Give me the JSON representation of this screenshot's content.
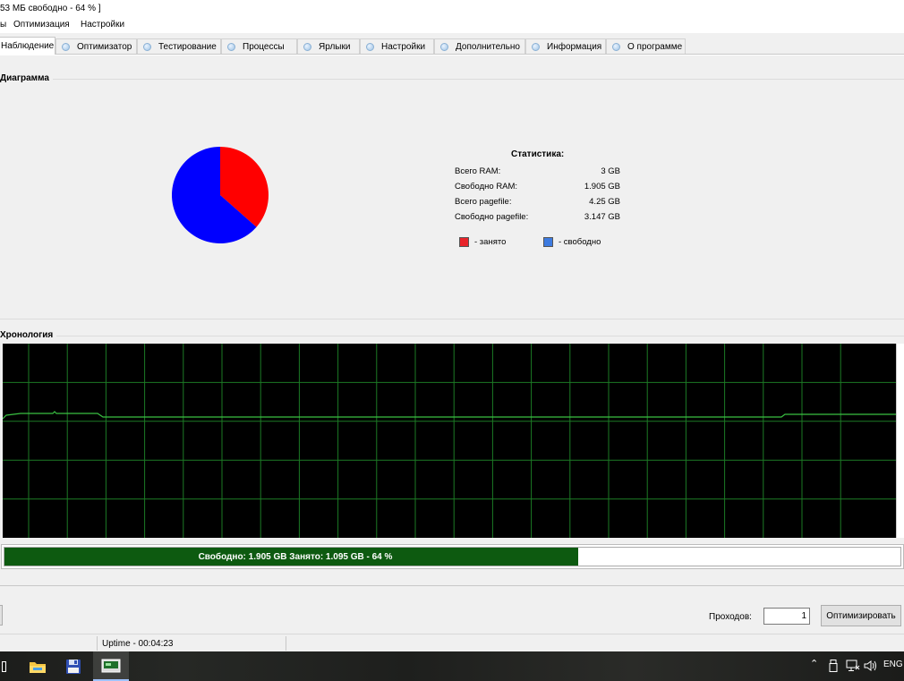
{
  "window": {
    "title_fragment": "53 МБ свободно - 64 % ]"
  },
  "menu": {
    "items": [
      "ы",
      "Оптимизация",
      "Настройки"
    ]
  },
  "tabs": [
    {
      "label": "Наблюдение",
      "active": true
    },
    {
      "label": "Оптимизатор"
    },
    {
      "label": "Тестирование"
    },
    {
      "label": "Процессы"
    },
    {
      "label": "Ярлыки"
    },
    {
      "label": "Настройки"
    },
    {
      "label": "Дополнительно"
    },
    {
      "label": "Информация"
    },
    {
      "label": "О программе"
    }
  ],
  "diagram": {
    "title": "Диаграмма",
    "stats_title": "Статистика:",
    "stats": [
      {
        "label": "Всего RAM:",
        "value": "3 GB"
      },
      {
        "label": "Свободно RAM:",
        "value": "1.905 GB"
      },
      {
        "label": "Всего pagefile:",
        "value": "4.25 GB"
      },
      {
        "label": "Свободно pagefile:",
        "value": "3.147 GB"
      }
    ],
    "legend": [
      {
        "label": "- занято",
        "color": "#e8242a"
      },
      {
        "label": "- свободно",
        "color": "#3d7be0"
      }
    ]
  },
  "chart_data": {
    "type": "pie",
    "slices": [
      {
        "label": "- занято",
        "value": 1.095,
        "color": "#ff0000"
      },
      {
        "label": "- свободно",
        "value": 1.905,
        "color": "#0000ff"
      }
    ]
  },
  "history": {
    "title": "Хронология",
    "grid_color": "#1c7a25",
    "line_color": "#39c042"
  },
  "progress": {
    "text": "Свободно: 1.905 GB  Занято: 1.095 GB - 64 %",
    "percent": 64,
    "color": "#0d5a10"
  },
  "controls": {
    "passes_label": "Проходов:",
    "passes_value": "1",
    "optimize_label": "Оптимизировать"
  },
  "status": {
    "uptime": "Uptime - 00:04:23"
  },
  "taskbar": {
    "language": "ENG",
    "items": [
      "file-explorer-icon",
      "floppy-save-icon",
      "ram-app-icon"
    ]
  }
}
